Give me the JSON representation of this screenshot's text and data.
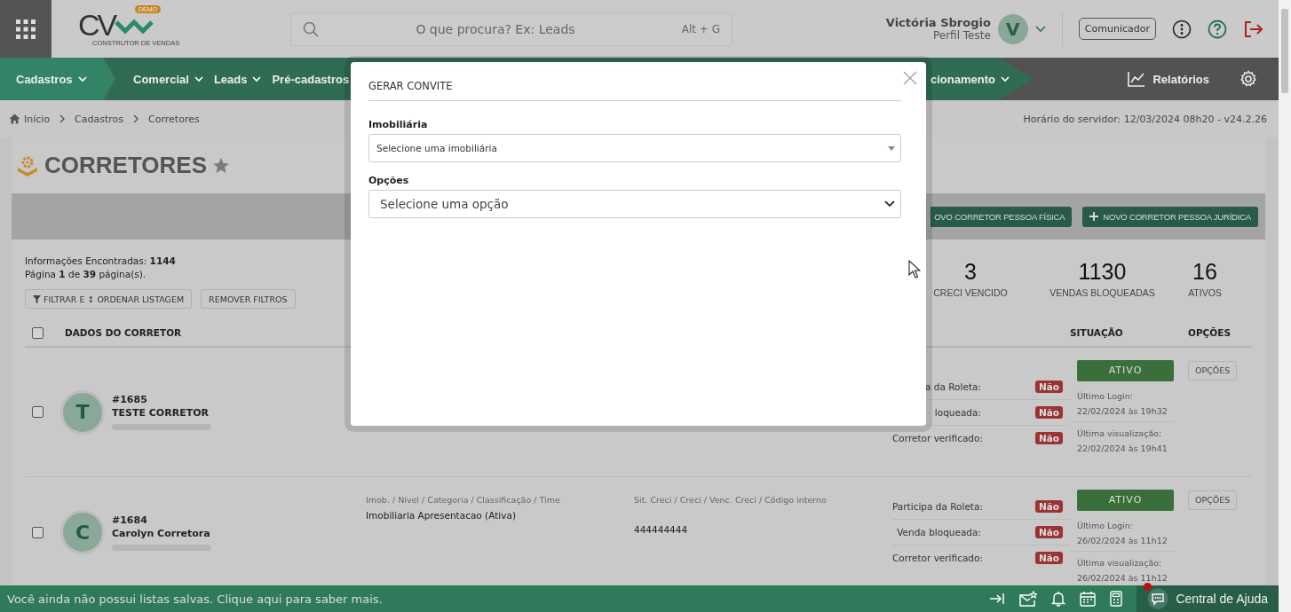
{
  "header": {
    "logo": {
      "mark": "CV",
      "badge": "DEMO",
      "tagline": "CONSTRUTOR DE VENDAS"
    },
    "search": {
      "placeholder": "O que procura? Ex: Leads",
      "shortcut": "Alt + G"
    },
    "user": {
      "name": "Victória Sbrogio",
      "profile": "Perfil Teste",
      "initial": "V"
    },
    "communicator": "Comunicador"
  },
  "nav": {
    "items": [
      {
        "label": "Cadastros",
        "selected": true,
        "caret": true
      },
      {
        "label": "Comercial",
        "selected": false,
        "caret": true
      },
      {
        "label": "Leads",
        "selected": false,
        "caret": true
      },
      {
        "label": "Pré-cadastros",
        "selected": false,
        "caret": false
      }
    ],
    "right_item": {
      "label": "cionamento",
      "caret": true
    },
    "reports": "Relatórios"
  },
  "breadcrumb": {
    "items": [
      "Início",
      "Cadastros",
      "Corretores"
    ],
    "server_time": "Horário do servidor: 12/03/2024 08h20 - v24.2.26"
  },
  "page": {
    "title": "CORRETORES",
    "toolbar_buttons": [
      {
        "label": "OVO CORRETOR PESSOA FÍSICA",
        "plus": false
      },
      {
        "label": "NOVO CORRETOR PESSOA JURÍDICA",
        "plus": true
      }
    ],
    "summary": [
      "Informações Encontradas: **1144**",
      "Página **1** de **39** página(s)."
    ],
    "filter_buttons": [
      {
        "label": "FILTRAR E ↕ ORDENAR LISTAGEM",
        "funnel": true
      },
      {
        "label": "REMOVER FILTROS",
        "funnel": false
      }
    ],
    "stats": [
      {
        "value": "3",
        "label": "CRECI VENCIDO"
      },
      {
        "value": "1130",
        "label": "VENDAS BLOQUEADAS"
      },
      {
        "value": "16",
        "label": "ATIVOS"
      }
    ]
  },
  "table": {
    "select_all": false,
    "columns": [
      "DADOS DO CORRETOR",
      "SITUAÇÃO",
      "OPÇÕES"
    ],
    "rows": [
      {
        "checked": false,
        "initial": "T",
        "id": "#1685",
        "name": "TESTE CORRETOR",
        "flags": [
          {
            "label": "a da Roleta:",
            "value": "Não"
          },
          {
            "label": "loqueada:",
            "value": "Não"
          },
          {
            "label": "Corretor verificado:",
            "value": "Não"
          }
        ],
        "status": "ATIVO",
        "login_label": "Último Login:",
        "login": "22/02/2024 às 19h32",
        "view_label": "Última visualização:",
        "view": "22/02/2024 às 19h41",
        "options": "OPÇÕES"
      },
      {
        "checked": false,
        "initial": "C",
        "id": "#1684",
        "name": "Carolyn Corretora",
        "imob_heading": "Imob. / Nível / Categoria / Classificação / Time",
        "imob": "Imobiliaria Apresentacao (Ativa)",
        "creci_heading": "Sit. Creci / Creci / Venc. Creci / Código interno",
        "creci": "444444444",
        "flags": [
          {
            "label": "Participa da Roleta:",
            "value": "Não"
          },
          {
            "label": "Venda bloqueada:",
            "value": "Não"
          },
          {
            "label": "Corretor verificado:",
            "value": "Não"
          }
        ],
        "status": "ATIVO",
        "login_label": "Último Login:",
        "login": "26/02/2024 às 11h12",
        "view_label": "Última visualização:",
        "view": "26/02/2024 às 11h12",
        "options": "OPÇÕES"
      }
    ]
  },
  "modal": {
    "title": "GERAR CONVITE",
    "fields": [
      {
        "label": "Imobiliária",
        "value": "Selecione uma imobiliária",
        "kind": "compact"
      },
      {
        "label": "Opções",
        "value": "Selecione uma opção",
        "kind": "native"
      }
    ]
  },
  "footer": {
    "message": "Você ainda não possui listas salvas. Clique aqui para saber mais.",
    "help": "Central de Ajuda",
    "notification": true
  }
}
